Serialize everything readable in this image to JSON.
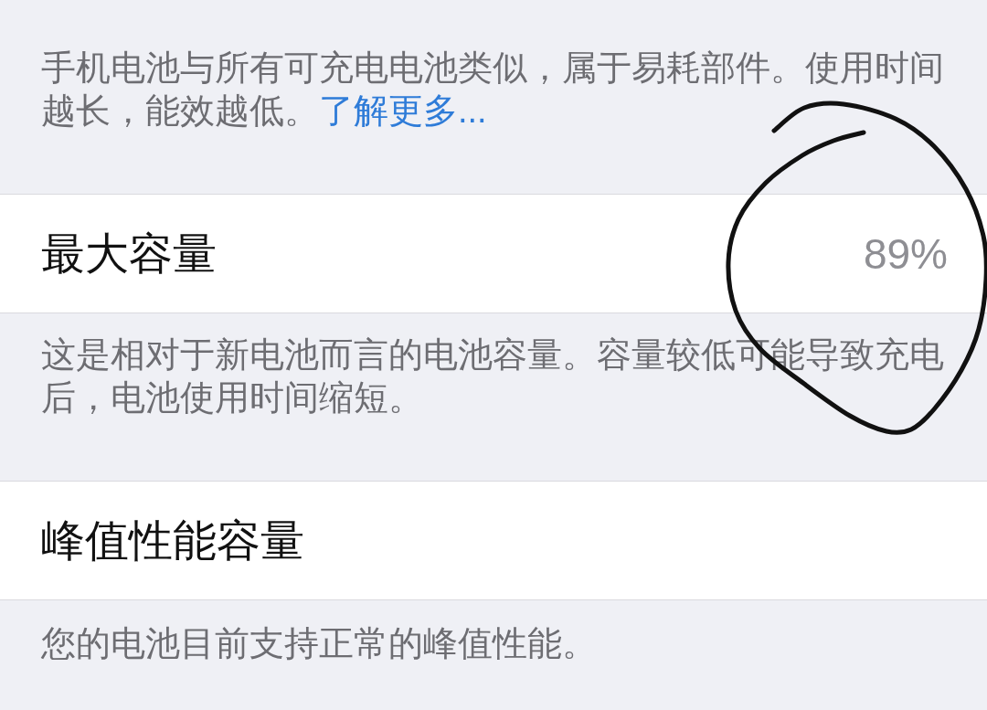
{
  "groups": [
    {
      "footer": "手机电池与所有可充电电池类似，属于易耗部件。使用时间越长，能效越低。",
      "footer_link": "了解更多..."
    },
    {
      "row": {
        "label": "最大容量",
        "value": "89%"
      },
      "footer": "这是相对于新电池而言的电池容量。容量较低可能导致充电后，电池使用时间缩短。"
    },
    {
      "row": {
        "label": "峰值性能容量"
      },
      "footer": "您的电池目前支持正常的峰值性能。"
    }
  ]
}
